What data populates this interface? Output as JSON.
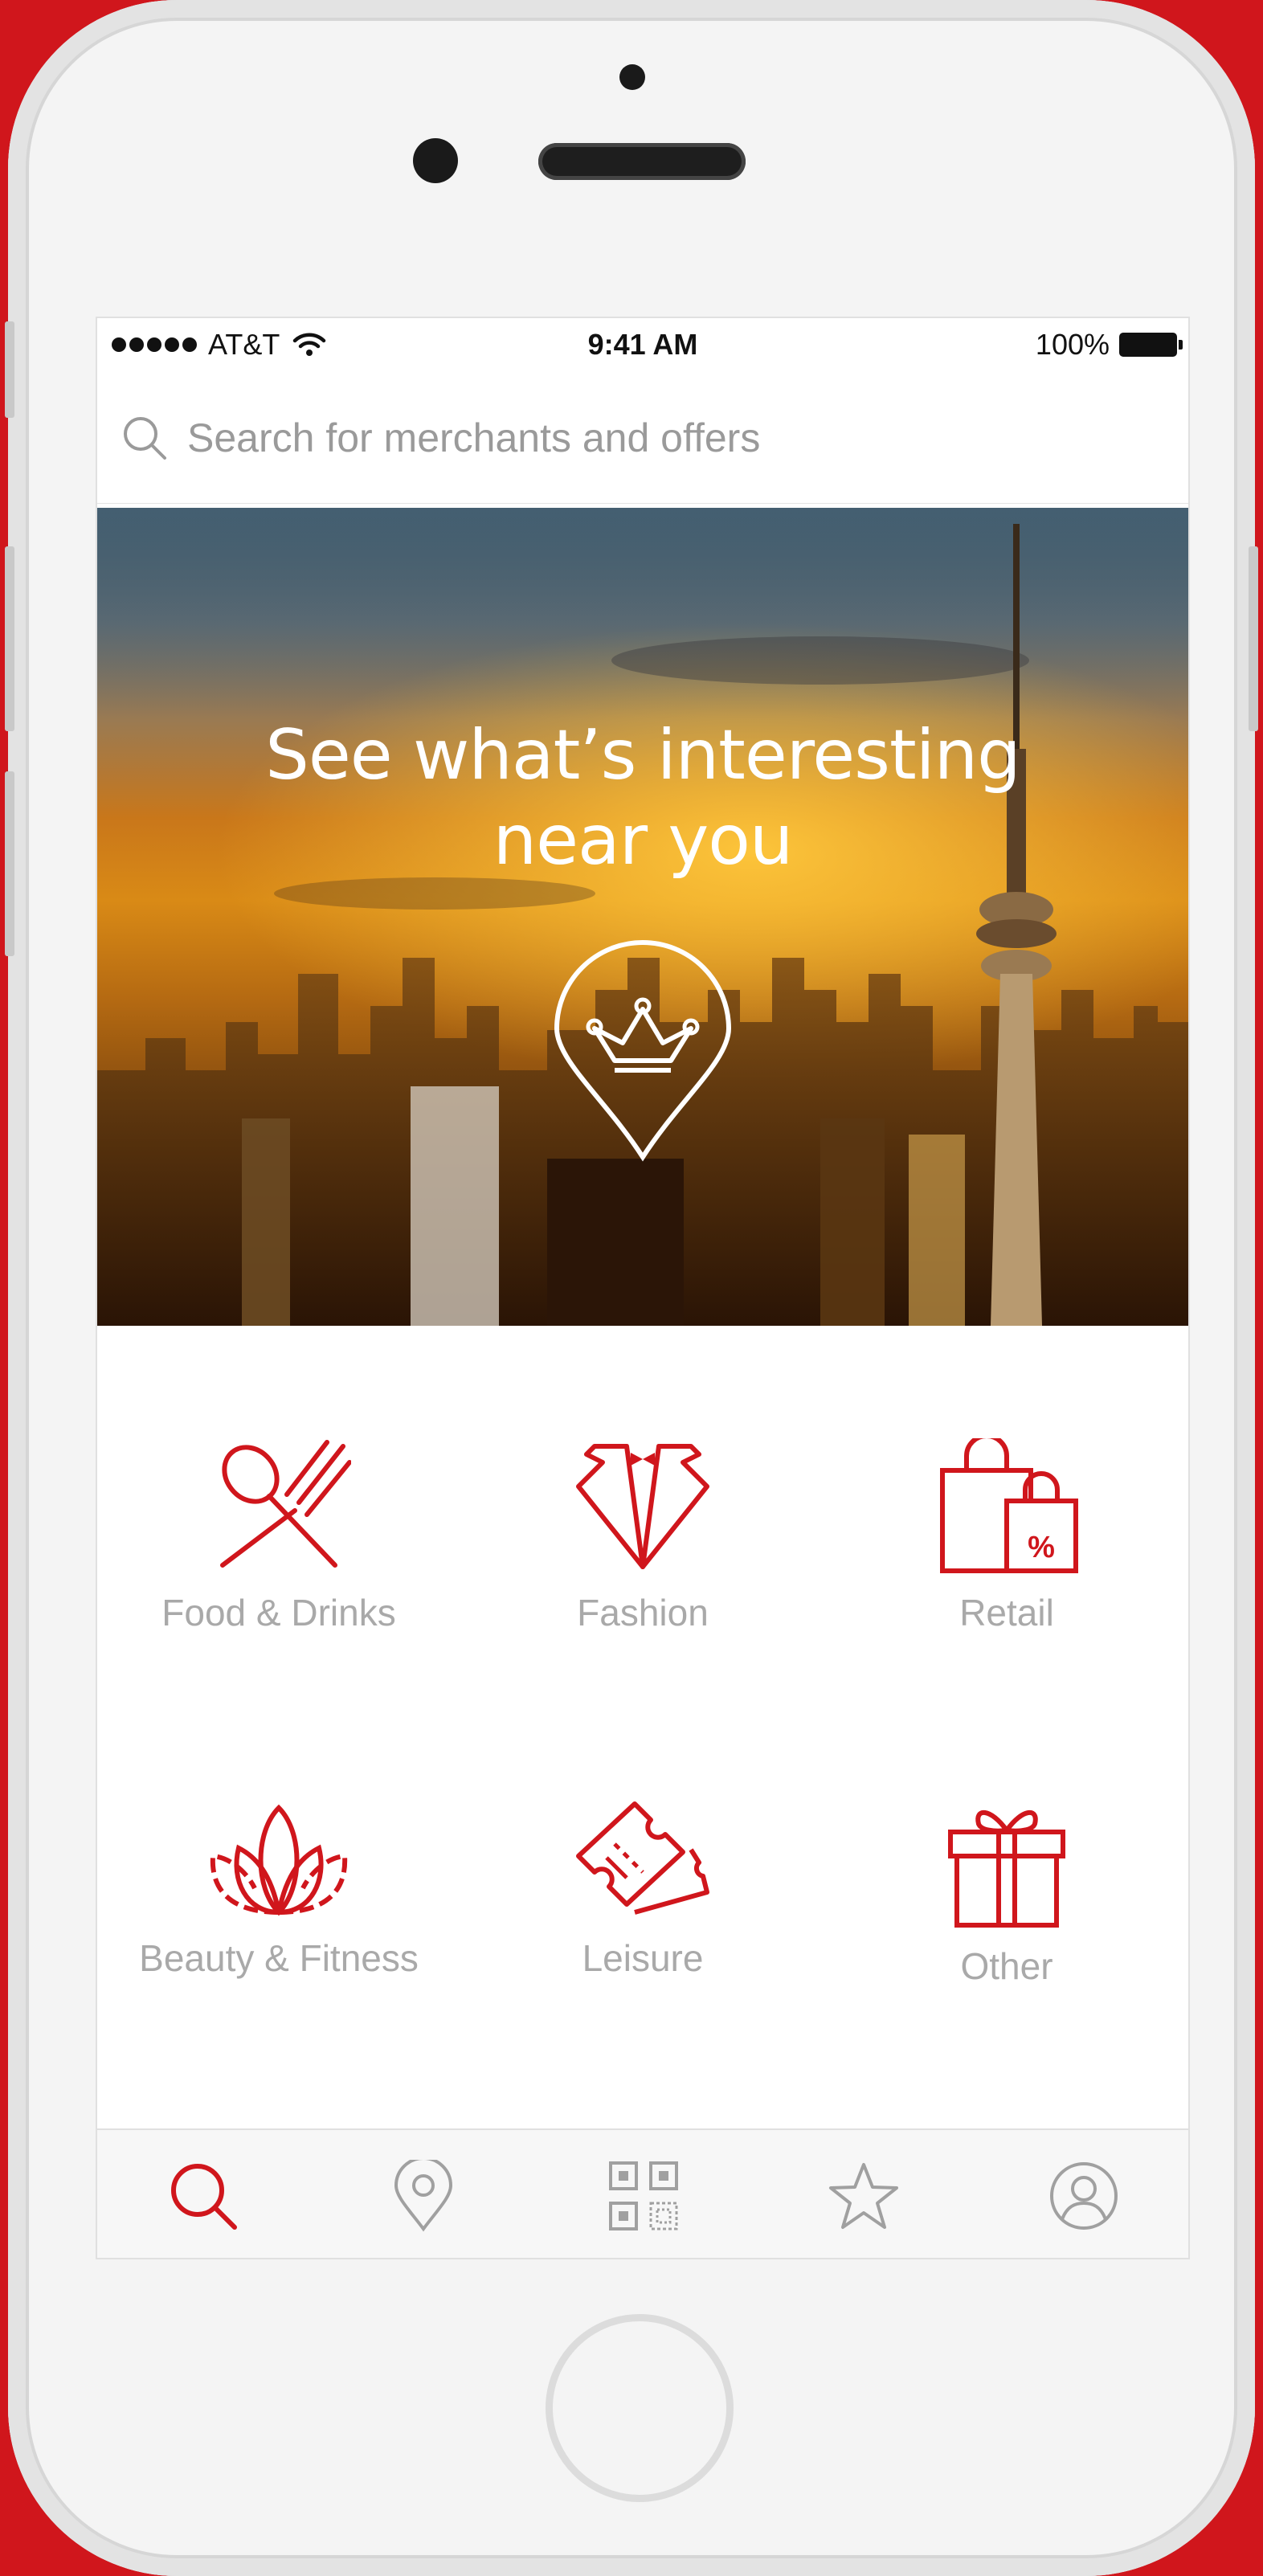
{
  "status_bar": {
    "carrier": "AT&T",
    "time": "9:41 AM",
    "battery": "100%"
  },
  "search": {
    "placeholder": "Search for merchants and offers",
    "icon": "search-icon"
  },
  "hero": {
    "title_line1": "See what’s interesting",
    "title_line2": "near you",
    "icon": "crown-location-pin-icon"
  },
  "categories": [
    {
      "label": "Food & Drinks",
      "icon": "fork-spoon-icon"
    },
    {
      "label": "Fashion",
      "icon": "tuxedo-icon"
    },
    {
      "label": "Retail",
      "icon": "shopping-bags-icon"
    },
    {
      "label": "Beauty & Fitness",
      "icon": "lotus-icon"
    },
    {
      "label": "Leisure",
      "icon": "tickets-icon"
    },
    {
      "label": "Other",
      "icon": "gift-icon"
    }
  ],
  "tabbar": {
    "tabs": [
      {
        "icon": "search-icon",
        "active": true
      },
      {
        "icon": "location-pin-icon",
        "active": false
      },
      {
        "icon": "qr-code-icon",
        "active": false
      },
      {
        "icon": "star-icon",
        "active": false
      },
      {
        "icon": "user-icon",
        "active": false
      }
    ]
  },
  "colors": {
    "accent": "#d0161c",
    "label_gray": "#a9a9a9",
    "inactive_icon": "#a0a0a0"
  }
}
